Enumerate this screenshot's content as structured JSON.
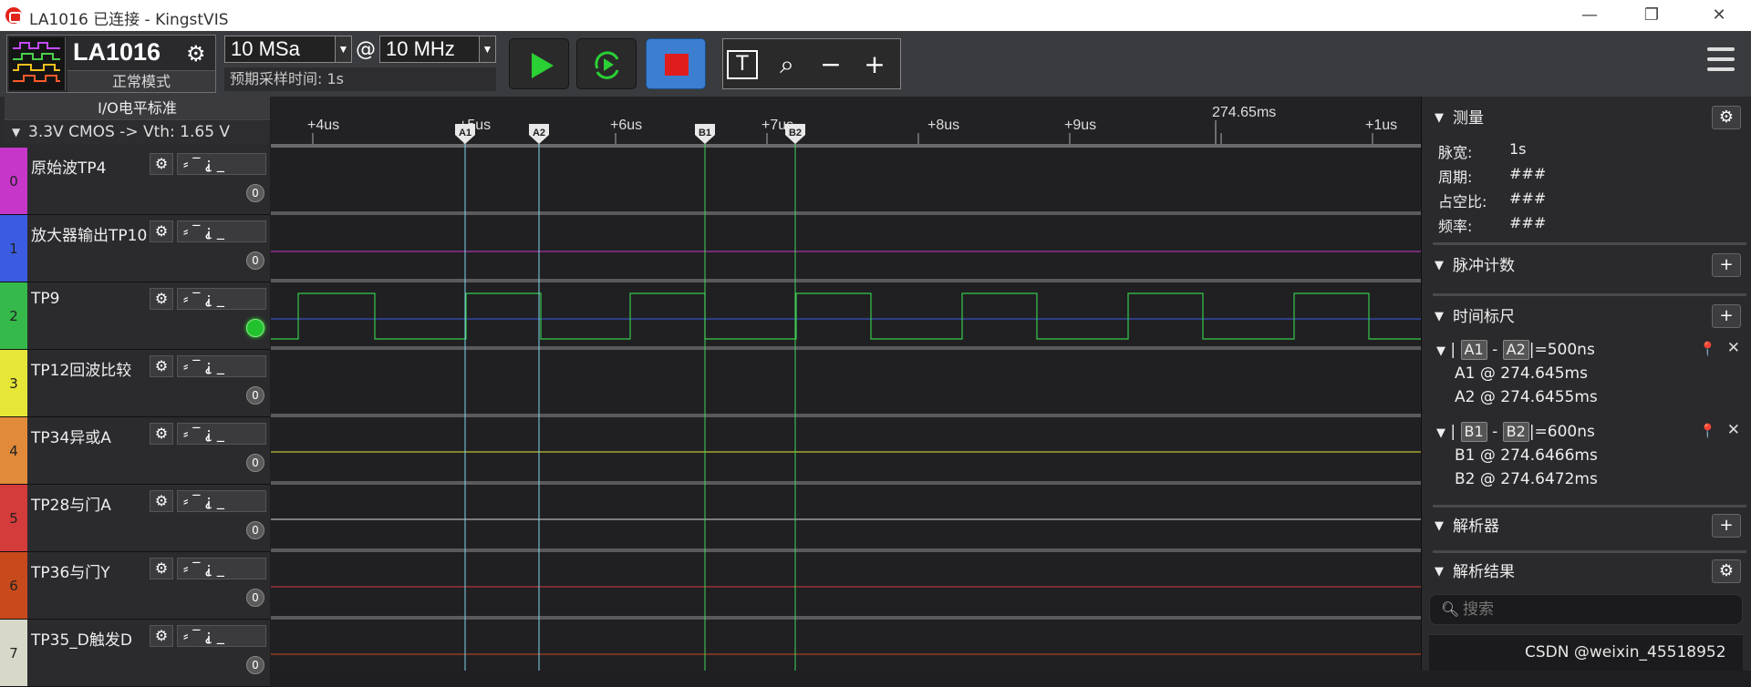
{
  "window": {
    "title": "LA1016 已连接 - KingstVIS",
    "minimize": "—",
    "maximize": "❐",
    "close": "✕"
  },
  "toolbar": {
    "device_name": "LA1016",
    "device_mode": "正常模式",
    "sample_depth": "10 MSa",
    "at_sign": "@",
    "sample_rate": "10 MHz",
    "sample_time": "预期采样时间: 1s",
    "tools": [
      "T",
      "⌕",
      "−",
      "+"
    ]
  },
  "channels": {
    "io_standard_title": "I/O电平标准",
    "io_standard_value": "3.3V CMOS  -> Vth: 1.65 V",
    "trigger_glyphs": "⸗‾⸘_",
    "gear": "⚙",
    "items": [
      {
        "num": "0",
        "name": "原始波TP4",
        "color": "#c637c9",
        "badge": "0"
      },
      {
        "num": "1",
        "name": "放大器输出TP10",
        "color": "#3b5ce0",
        "badge": "0"
      },
      {
        "num": "2",
        "name": "TP9",
        "color": "#35b94a",
        "badge": ""
      },
      {
        "num": "3",
        "name": "TP12回波比较",
        "color": "#e6e637",
        "badge": "0"
      },
      {
        "num": "4",
        "name": "TP34异或A",
        "color": "#e08a3a",
        "badge": "0"
      },
      {
        "num": "5",
        "name": "TP28与门A",
        "color": "#d43b3b",
        "badge": "0"
      },
      {
        "num": "6",
        "name": "TP36与门Y",
        "color": "#c84a1c",
        "badge": "0"
      },
      {
        "num": "7",
        "name": "TP35_D触发D",
        "color": "#d8d8c8",
        "badge": "0"
      }
    ]
  },
  "timeline": {
    "center_label": "274.65ms",
    "ticks": [
      "+4us",
      "+5us",
      "+6us",
      "+7us",
      "+8us",
      "+9us",
      "+1us"
    ],
    "markers": [
      "A1",
      "A2",
      "B1",
      "B2"
    ]
  },
  "right_panel": {
    "measure_title": "测量",
    "measure": [
      {
        "k": "脉宽:",
        "v": "1s"
      },
      {
        "k": "周期:",
        "v": "###"
      },
      {
        "k": "占空比:",
        "v": "###"
      },
      {
        "k": "频率:",
        "v": "###"
      }
    ],
    "pulse_count_title": "脉冲计数",
    "time_ruler_title": "时间标尺",
    "pair_a": {
      "t1": "A1",
      "t2": "A2",
      "delta": "=500ns",
      "line1": "A1 @ 274.645ms",
      "line2": "A2 @ 274.6455ms"
    },
    "pair_b": {
      "t1": "B1",
      "t2": "B2",
      "delta": "=600ns",
      "line1": "B1 @ 274.6466ms",
      "line2": "B2 @ 274.6472ms"
    },
    "analyzer_title": "解析器",
    "result_title": "解析结果",
    "search_placeholder": "搜索",
    "plus": "+",
    "gear": "⚙"
  },
  "watermark": "CSDN @weixin_45518952"
}
